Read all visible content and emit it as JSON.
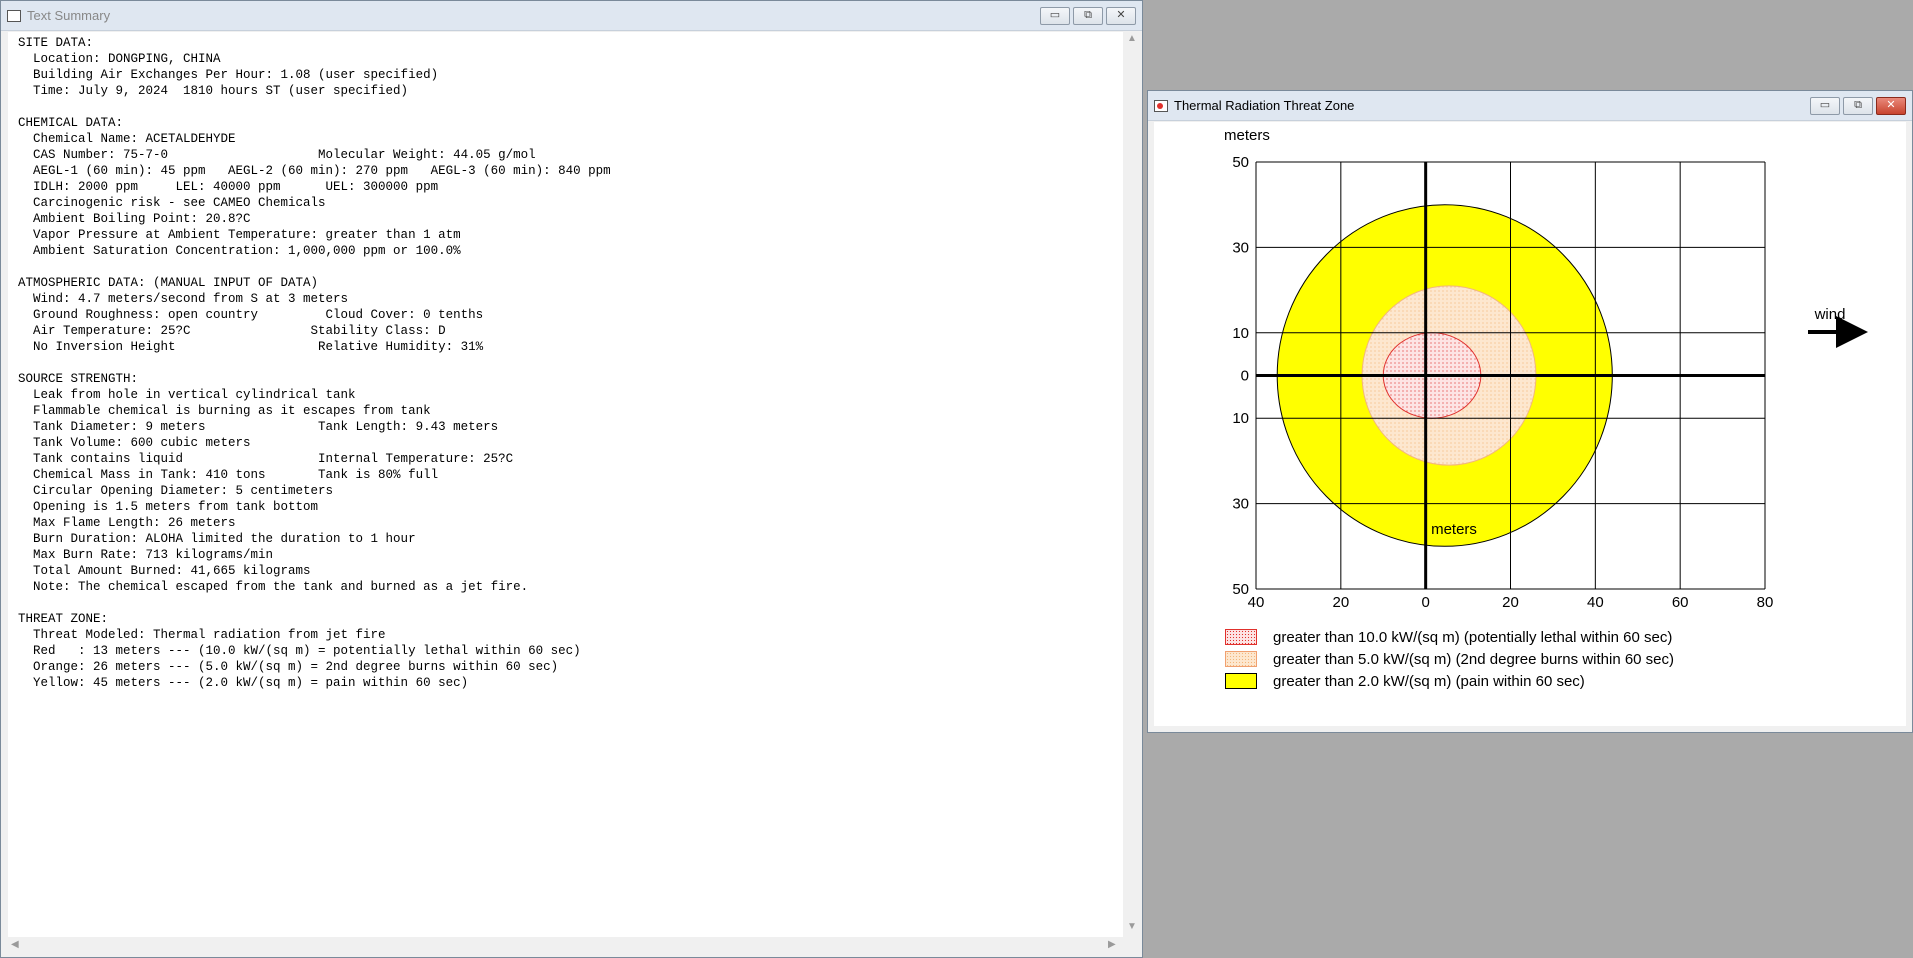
{
  "text_window": {
    "title": "Text Summary",
    "report_lines": [
      "SITE DATA:",
      "  Location: DONGPING, CHINA",
      "  Building Air Exchanges Per Hour: 1.08 (user specified)",
      "  Time: July 9, 2024  1810 hours ST (user specified)",
      "",
      "CHEMICAL DATA:",
      "  Chemical Name: ACETALDEHYDE",
      "  CAS Number: 75-7-0                    Molecular Weight: 44.05 g/mol",
      "  AEGL-1 (60 min): 45 ppm   AEGL-2 (60 min): 270 ppm   AEGL-3 (60 min): 840 ppm",
      "  IDLH: 2000 ppm     LEL: 40000 ppm      UEL: 300000 ppm",
      "  Carcinogenic risk - see CAMEO Chemicals",
      "  Ambient Boiling Point: 20.8?C",
      "  Vapor Pressure at Ambient Temperature: greater than 1 atm",
      "  Ambient Saturation Concentration: 1,000,000 ppm or 100.0%",
      "",
      "ATMOSPHERIC DATA: (MANUAL INPUT OF DATA)",
      "  Wind: 4.7 meters/second from S at 3 meters",
      "  Ground Roughness: open country         Cloud Cover: 0 tenths",
      "  Air Temperature: 25?C                Stability Class: D",
      "  No Inversion Height                   Relative Humidity: 31%",
      "",
      "SOURCE STRENGTH:",
      "  Leak from hole in vertical cylindrical tank",
      "  Flammable chemical is burning as it escapes from tank",
      "  Tank Diameter: 9 meters               Tank Length: 9.43 meters",
      "  Tank Volume: 600 cubic meters",
      "  Tank contains liquid                  Internal Temperature: 25?C",
      "  Chemical Mass in Tank: 410 tons       Tank is 80% full",
      "  Circular Opening Diameter: 5 centimeters",
      "  Opening is 1.5 meters from tank bottom",
      "  Max Flame Length: 26 meters",
      "  Burn Duration: ALOHA limited the duration to 1 hour",
      "  Max Burn Rate: 713 kilograms/min",
      "  Total Amount Burned: 41,665 kilograms",
      "  Note: The chemical escaped from the tank and burned as a jet fire.",
      "",
      "THREAT ZONE:",
      "  Threat Modeled: Thermal radiation from jet fire",
      "  Red   : 13 meters --- (10.0 kW/(sq m) = potentially lethal within 60 sec)",
      "  Orange: 26 meters --- (5.0 kW/(sq m) = 2nd degree burns within 60 sec)",
      "  Yellow: 45 meters --- (2.0 kW/(sq m) = pain within 60 sec)"
    ]
  },
  "threat_window": {
    "title": "Thermal Radiation Threat Zone",
    "wind_label": "wind"
  },
  "window_buttons": {
    "minimize": "▭",
    "maximize": "⧉",
    "close": "✕"
  },
  "chart_data": {
    "type": "threat-zone-plot",
    "ylabel": "meters",
    "xlabel": "meters",
    "xlim": [
      -40,
      80
    ],
    "ylim": [
      -50,
      50
    ],
    "x_ticks": [
      -40,
      -20,
      0,
      20,
      40,
      60,
      80
    ],
    "x_tick_labels": [
      "40",
      "20",
      "0",
      "20",
      "40",
      "60",
      "80"
    ],
    "y_ticks": [
      50,
      30,
      10,
      0,
      -10,
      -30,
      -50
    ],
    "y_tick_labels": [
      "50",
      "30",
      "10",
      "0",
      "10",
      "30",
      "50"
    ],
    "grid": true,
    "zones": [
      {
        "name": "red",
        "label": "greater than 10.0 kW/(sq m) (potentially lethal within 60 sec)",
        "cx": 1.5,
        "cy": 0,
        "rx": 11.5,
        "ry": 10,
        "fill": "#fde4e4",
        "stroke": "#e0302c"
      },
      {
        "name": "orange",
        "label": "greater than 5.0 kW/(sq m) (2nd degree burns within 60 sec)",
        "cx": 5.5,
        "cy": 0,
        "rx": 20.5,
        "ry": 21,
        "fill": "#fde7cf",
        "stroke": "#f3b77a"
      },
      {
        "name": "yellow",
        "label": "greater than 2.0 kW/(sq m) (pain within 60 sec)",
        "cx": 4.5,
        "cy": 0,
        "rx": 39.5,
        "ry": 40,
        "fill": "#ffff00",
        "stroke": "#000000"
      }
    ],
    "colors": {
      "axis": "#000000",
      "grid": "#000000"
    }
  }
}
